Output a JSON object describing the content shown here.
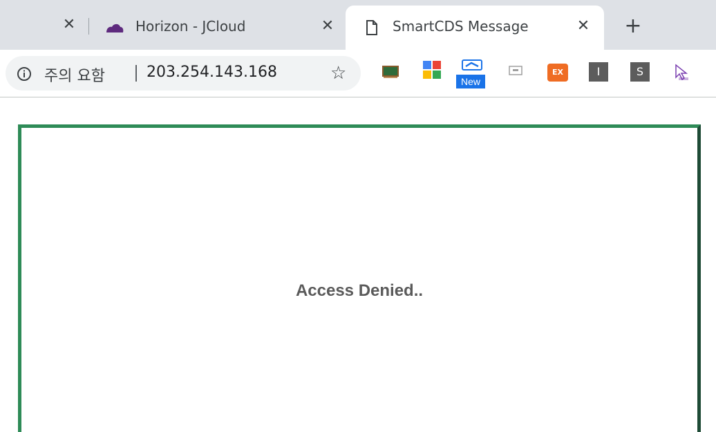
{
  "tabs": [
    {
      "title": "Horizon - JCloud",
      "icon": "cloud-icon",
      "active": false
    },
    {
      "title": "SmartCDS Message",
      "icon": "page-icon",
      "active": true
    }
  ],
  "tab_close_symbol": "✕",
  "new_tab_symbol": "+",
  "address_bar": {
    "security_text": "주의 요함",
    "url": "203.254.143.168",
    "star_symbol": "☆"
  },
  "bookmarks": [
    {
      "icon": "chalkboard-icon"
    },
    {
      "icon": "google-apps-icon"
    },
    {
      "icon": "new-app-icon",
      "badge": "New"
    },
    {
      "icon": "keyboard-icon"
    },
    {
      "icon": "ex-icon",
      "label": "EX"
    },
    {
      "icon": "i-bookmark-icon",
      "label": "I"
    },
    {
      "icon": "s-bookmark-icon",
      "label": "S"
    },
    {
      "icon": "cursor-clean-icon"
    }
  ],
  "page": {
    "message": "Access Denied.."
  },
  "colors": {
    "border_green": "#2e8b57",
    "border_dark": "#1e4b36",
    "message_text": "#5a5a5a",
    "tabbar_bg": "#dee1e6"
  }
}
